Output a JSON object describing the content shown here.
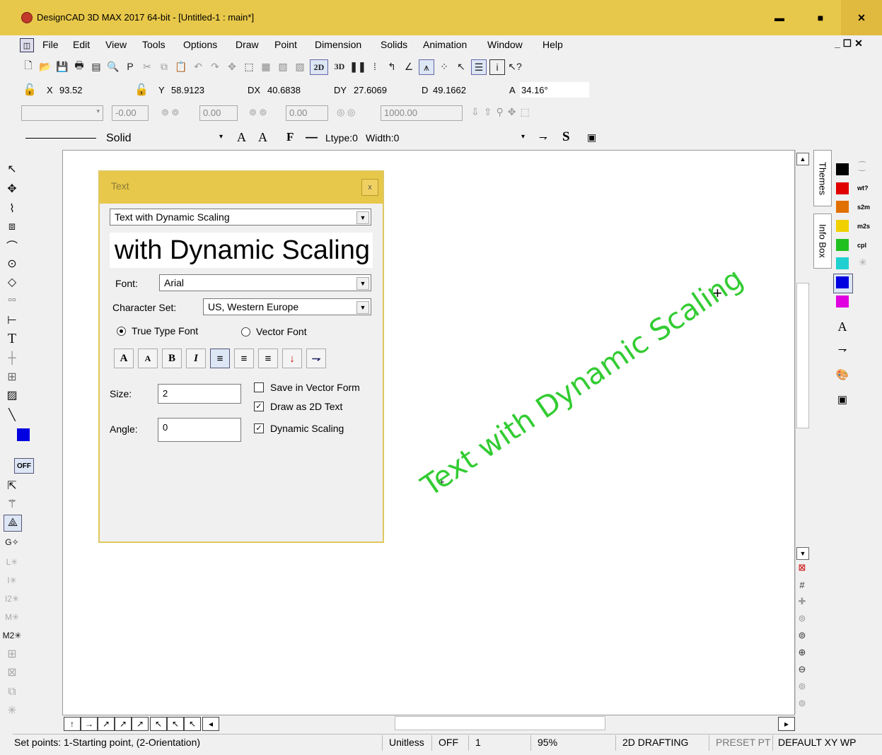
{
  "window": {
    "title": "DesignCAD 3D MAX 2017 64-bit - [Untitled-1 : main*]",
    "min": "▬",
    "max": "■",
    "close": "✕",
    "mdi_controls": "_ ☐ ✕"
  },
  "menu": [
    "File",
    "Edit",
    "View",
    "Tools",
    "Options",
    "Draw",
    "Point",
    "Dimension",
    "Solids",
    "Animation",
    "Window",
    "Help"
  ],
  "coords": {
    "x_label": "X",
    "x_value": "93.52",
    "y_label": "Y",
    "y_value": "58.9123",
    "dx_label": "DX",
    "dx_value": "40.6838",
    "dy_label": "DY",
    "dy_value": "27.6069",
    "d_label": "D",
    "d_value": "49.1662",
    "a_label": "A",
    "a_value": "34.16°"
  },
  "fields_row": {
    "f1": "-0.00",
    "f2": "0.00",
    "f3": "0.00",
    "f4": "1000.00"
  },
  "linestyle": {
    "style": "Solid",
    "ltype": "Ltype:0",
    "width": "Width:0"
  },
  "left_toolbar": {
    "off_label": "OFF"
  },
  "text_dialog": {
    "title": "Text",
    "close": "x",
    "mode": "Text with Dynamic Scaling",
    "preview": "with Dynamic Scaling",
    "font_label": "Font:",
    "font_value": "Arial",
    "charset_label": "Character Set:",
    "charset_value": "US, Western Europe",
    "truetype": "True Type Font",
    "vector": "Vector Font",
    "size_label": "Size:",
    "size_value": "2",
    "angle_label": "Angle:",
    "angle_value": "0",
    "save_vector": "Save in Vector Form",
    "draw2d": "Draw as 2D Text",
    "dynscale": "Dynamic Scaling"
  },
  "canvas": {
    "text": "Text with Dynamic Scaling",
    "text_color": "#33cc33"
  },
  "right_panel": {
    "themes": "Themes",
    "infobox": "Info Box",
    "labels": [
      "wt?",
      "s2m",
      "m2s",
      "cpl"
    ],
    "colors": [
      "#000000",
      "#e00000",
      "#e07000",
      "#f0d000",
      "#20c020",
      "#20d0d0",
      "#0000e0",
      "#e000e0"
    ]
  },
  "statusbar": {
    "message": "Set points: 1-Starting point, (2-Orientation)",
    "units": "Unitless",
    "snap": "OFF",
    "layer": "1",
    "zoom": "95%",
    "mode": "2D DRAFTING",
    "preset": "PRESET PT",
    "wp": "DEFAULT XY WP"
  }
}
